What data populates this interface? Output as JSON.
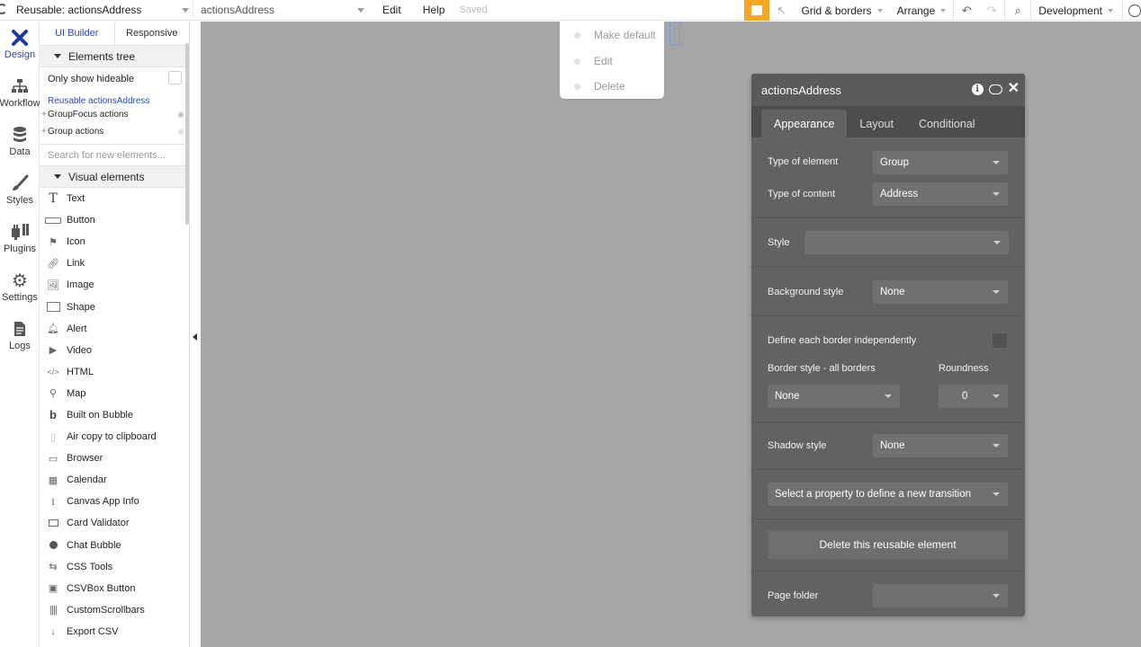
{
  "topbar": {
    "page_select": "Reusable: actionsAddress",
    "element_select": "actionsAddress",
    "menu_edit": "Edit",
    "menu_help": "Help",
    "saved_status": "Saved",
    "grid_borders": "Grid & borders",
    "arrange": "Arrange",
    "environment": "Development"
  },
  "leftnav": {
    "items": [
      {
        "label": "Design",
        "icon": "design-icon"
      },
      {
        "label": "Workflow",
        "icon": "workflow-icon"
      },
      {
        "label": "Data",
        "icon": "database-icon"
      },
      {
        "label": "Styles",
        "icon": "brush-icon"
      },
      {
        "label": "Plugins",
        "icon": "plug-icon"
      },
      {
        "label": "Settings",
        "icon": "gear-icon"
      },
      {
        "label": "Logs",
        "icon": "document-icon"
      }
    ]
  },
  "panel": {
    "tabs": [
      "UI Builder",
      "Responsive"
    ],
    "elements_tree_header": "Elements tree",
    "only_show_hideable": "Only show hideable",
    "tree_root": "Reusable actionsAddress",
    "tree_items": [
      "GroupFocus actions",
      "Group actions"
    ],
    "search_placeholder": "Search for new elements...",
    "visual_elements_header": "Visual elements",
    "elements": [
      "Text",
      "Button",
      "Icon",
      "Link",
      "Image",
      "Shape",
      "Alert",
      "Video",
      "HTML",
      "Map",
      "Built on Bubble",
      "Air copy to clipboard",
      "Browser",
      "Calendar",
      "Canvas App Info",
      "Card Validator",
      "Chat Bubble",
      "CSS Tools",
      "CSVBox Button",
      "CustomScrollbars",
      "Export CSV"
    ]
  },
  "context_menu": {
    "items": [
      "Make default",
      "Edit",
      "Delete"
    ]
  },
  "editor": {
    "title": "actionsAddress",
    "tabs": [
      "Appearance",
      "Layout",
      "Conditional"
    ],
    "type_of_element_label": "Type of element",
    "type_of_element_value": "Group",
    "type_of_content_label": "Type of content",
    "type_of_content_value": "Address",
    "style_label": "Style",
    "style_value": "",
    "background_style_label": "Background style",
    "background_style_value": "None",
    "define_border_label": "Define each border independently",
    "border_style_label": "Border style - all borders",
    "roundness_label": "Roundness",
    "border_style_value": "None",
    "roundness_value": "0",
    "shadow_style_label": "Shadow style",
    "shadow_style_value": "None",
    "transition_placeholder": "Select a property to define a new transition",
    "delete_button": "Delete this reusable element",
    "page_folder_label": "Page folder",
    "page_folder_value": ""
  },
  "colors": {
    "canvas": "#a6a6a6",
    "editor_bg": "#626262",
    "accent_blue": "#2b4aa8",
    "gift_orange": "#f5a623"
  }
}
